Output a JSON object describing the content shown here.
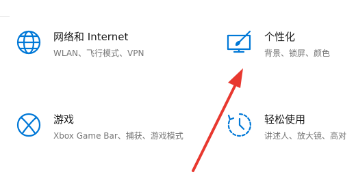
{
  "tiles": {
    "network": {
      "title": "网络和 Internet",
      "description": "WLAN、飞行模式、VPN",
      "icon": "globe-icon"
    },
    "personalization": {
      "title": "个性化",
      "description": "背景、锁屏、颜色",
      "icon": "paint-monitor-icon"
    },
    "gaming": {
      "title": "游戏",
      "description": "Xbox Game Bar、捕获、游戏模式",
      "icon": "xbox-icon"
    },
    "accessibility": {
      "title": "轻松使用",
      "description": "讲述人、放大镜、高对",
      "icon": "ease-of-access-icon"
    }
  },
  "colors": {
    "accent": "#0078d7",
    "arrow": "#e8382f",
    "title_text": "#1a1a1a",
    "description_text": "#767676",
    "background": "#ffffff"
  }
}
